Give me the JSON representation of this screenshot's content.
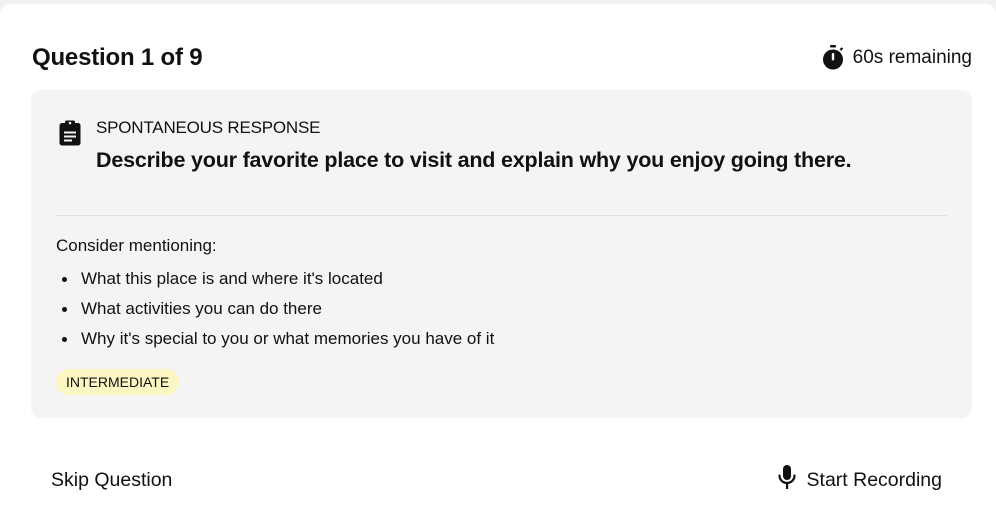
{
  "header": {
    "question_counter": "Question 1 of 9",
    "timer_icon": "stopwatch-icon",
    "timer_text": "60s remaining"
  },
  "question": {
    "type_icon": "clipboard-icon",
    "type_label": "SPONTANEOUS RESPONSE",
    "prompt": "Describe your favorite place to visit and explain why you enjoy going there.",
    "consider_label": "Consider mentioning:",
    "hints": [
      "What this place is and where it's located",
      "What activities you can do there",
      "Why it's special to you or what memories you have of it"
    ],
    "level_badge": "INTERMEDIATE"
  },
  "footer": {
    "skip_label": "Skip Question",
    "record_icon": "microphone-icon",
    "record_label": "Start Recording"
  },
  "colors": {
    "panel_background": "#f4f4f4",
    "badge_background": "#fdf6c3",
    "text": "#111111"
  }
}
